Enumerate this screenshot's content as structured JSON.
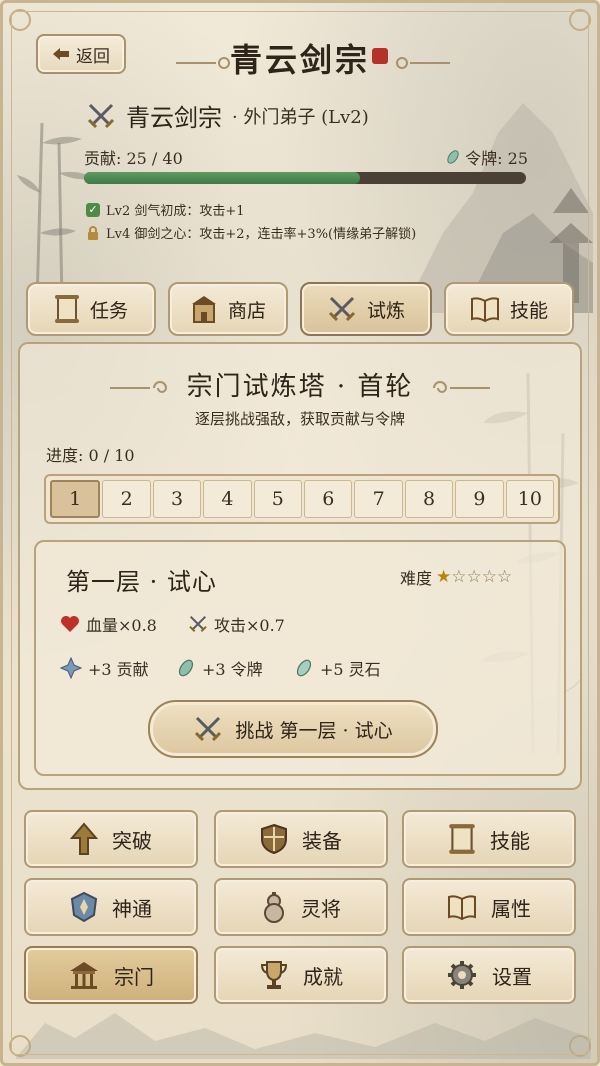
{
  "header": {
    "back_label": "返回",
    "title": "青云剑宗"
  },
  "sect": {
    "name": "青云剑宗",
    "rank": "· 外门弟子 (Lv2)",
    "contribution_text": "贡献: 25 / 40",
    "contribution_fraction": 0.625,
    "token_text": "令牌: 25"
  },
  "perks": [
    {
      "text": "Lv2 剑气初成：攻击+1",
      "unlocked": true
    },
    {
      "text": "Lv4 御剑之心：攻击+2，连击率+3%(情缘弟子解锁)",
      "unlocked": false
    }
  ],
  "tabs": [
    {
      "label": "任务",
      "icon": "scroll-icon"
    },
    {
      "label": "商店",
      "icon": "shop-icon"
    },
    {
      "label": "试炼",
      "icon": "crossed-swords-icon",
      "active": true
    },
    {
      "label": "技能",
      "icon": "book-icon"
    }
  ],
  "trial": {
    "title": "宗门试炼塔 · 首轮",
    "subtitle": "逐层挑战强敌，获取贡献与令牌",
    "progress": "进度: 0 / 10",
    "levels": [
      "1",
      "2",
      "3",
      "4",
      "5",
      "6",
      "7",
      "8",
      "9",
      "10"
    ],
    "selected_level": "1"
  },
  "floor": {
    "title": "第一层 · 试心",
    "difficulty_label": "难度",
    "difficulty_stars": 1,
    "difficulty_max": 5,
    "hp": "血量×0.8",
    "atk": "攻击×0.7",
    "rewards": [
      "+3 贡献",
      "+3 令牌",
      "+5 灵石"
    ],
    "challenge_label": "挑战  第一层 · 试心"
  },
  "menu": [
    {
      "label": "突破",
      "icon": "breakthrough-arrow-icon"
    },
    {
      "label": "装备",
      "icon": "shield-icon"
    },
    {
      "label": "技能",
      "icon": "scroll-icon"
    },
    {
      "label": "神通",
      "icon": "talisman-icon"
    },
    {
      "label": "灵将",
      "icon": "gourd-icon"
    },
    {
      "label": "属性",
      "icon": "book-icon"
    },
    {
      "label": "宗门",
      "icon": "pavilion-icon",
      "active": true
    },
    {
      "label": "成就",
      "icon": "trophy-icon"
    },
    {
      "label": "设置",
      "icon": "gear-icon"
    }
  ],
  "colors": {
    "accent": "#b09a72",
    "progress_fill": "#4f8a52",
    "seal_red": "#b5322a",
    "star_gold": "#b8860b"
  }
}
